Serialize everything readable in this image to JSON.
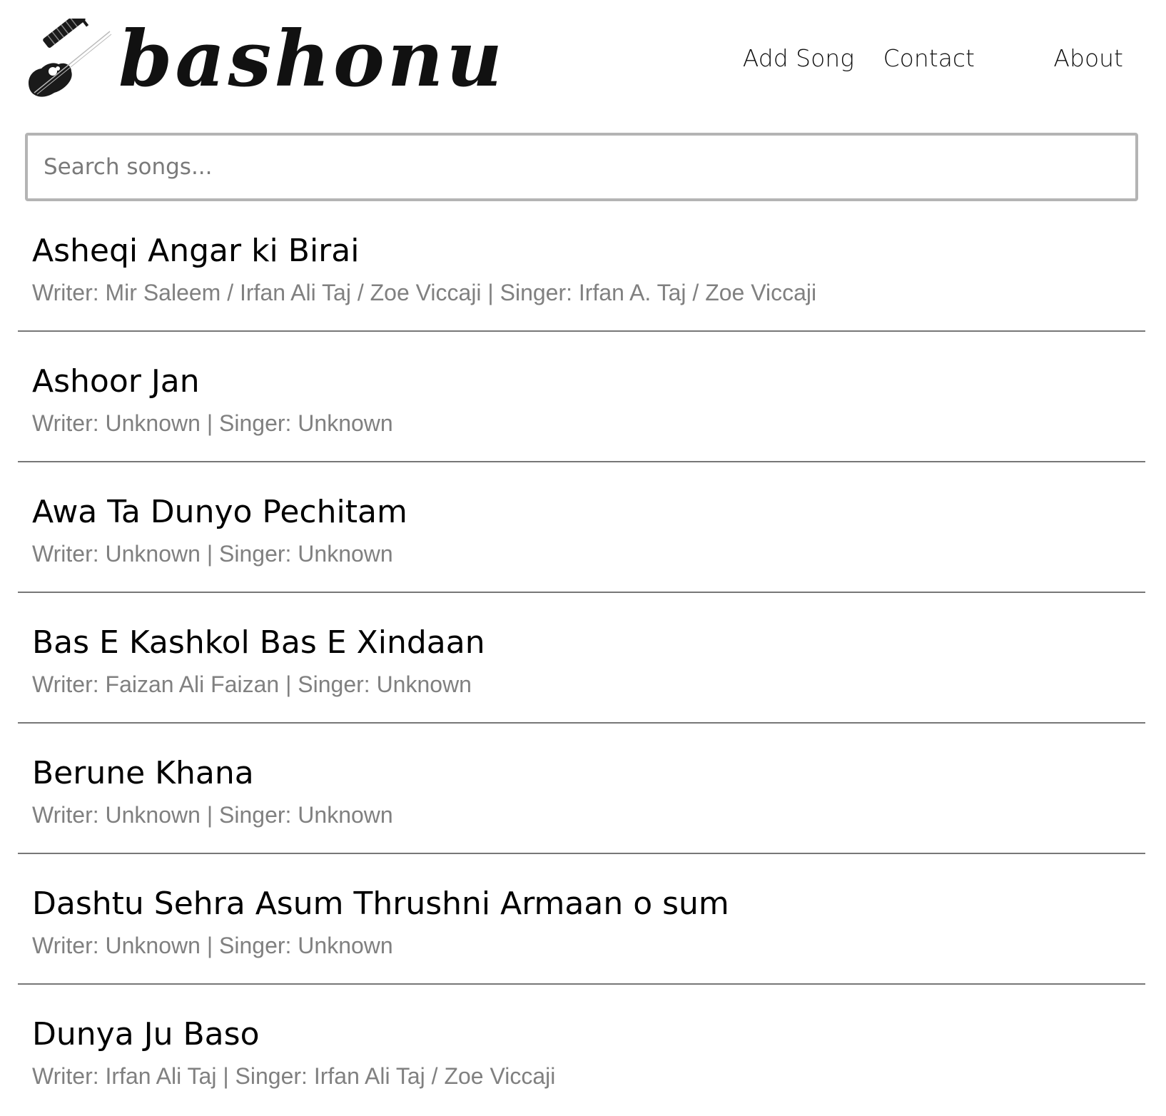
{
  "header": {
    "logo_text": "bashonu",
    "nav": [
      {
        "label": "Add Song"
      },
      {
        "label": "Contact"
      },
      {
        "label": "About"
      }
    ]
  },
  "search": {
    "placeholder": "Search songs...",
    "value": ""
  },
  "songs": [
    {
      "title": "Asheqi Angar ki Birai",
      "meta": "Writer: Mir Saleem / Irfan Ali Taj / Zoe Viccaji | Singer: Irfan A. Taj / Zoe Viccaji"
    },
    {
      "title": "Ashoor Jan",
      "meta": "Writer: Unknown | Singer: Unknown"
    },
    {
      "title": "Awa Ta Dunyo Pechitam",
      "meta": "Writer: Unknown | Singer: Unknown"
    },
    {
      "title": "Bas E Kashkol Bas E Xindaan",
      "meta": "Writer: Faizan Ali Faizan | Singer: Unknown"
    },
    {
      "title": "Berune Khana",
      "meta": "Writer: Unknown | Singer: Unknown"
    },
    {
      "title": "Dashtu Sehra Asum Thrushni Armaan o sum",
      "meta": "Writer: Unknown | Singer: Unknown"
    },
    {
      "title": "Dunya Ju Baso",
      "meta": "Writer: Irfan Ali Taj | Singer: Irfan Ali Taj / Zoe Viccaji"
    }
  ]
}
